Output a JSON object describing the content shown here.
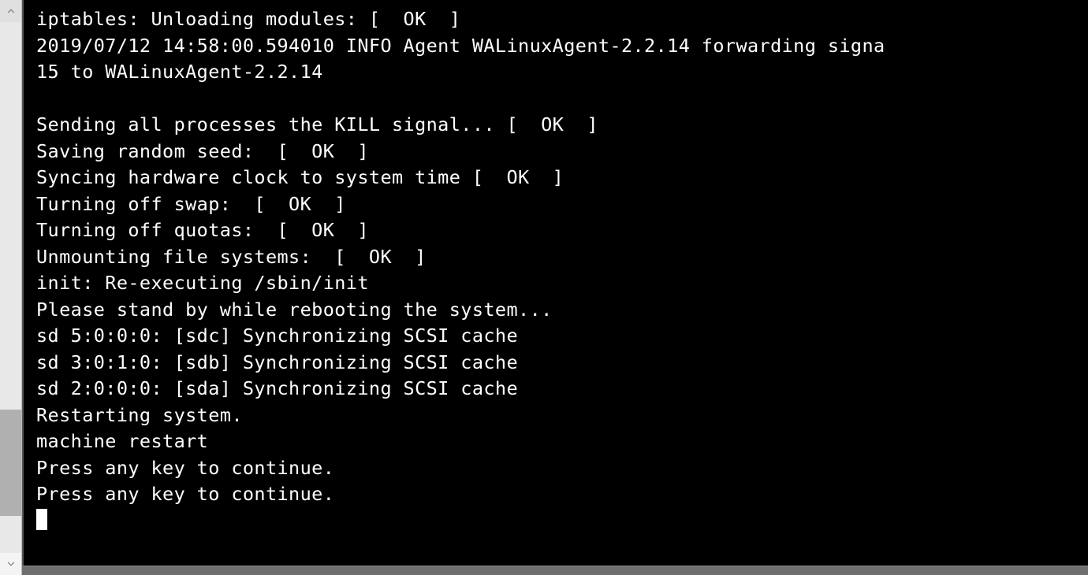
{
  "scrollbar": {
    "thumb_top_pct": 73,
    "thumb_height_pct": 20
  },
  "terminal": {
    "lines": [
      "iptables: Unloading modules: [  OK  ]",
      "2019/07/12 14:58:00.594010 INFO Agent WALinuxAgent-2.2.14 forwarding signa",
      "15 to WALinuxAgent-2.2.14",
      "",
      "Sending all processes the KILL signal... [  OK  ]",
      "Saving random seed:  [  OK  ]",
      "Syncing hardware clock to system time [  OK  ]",
      "Turning off swap:  [  OK  ]",
      "Turning off quotas:  [  OK  ]",
      "Unmounting file systems:  [  OK  ]",
      "init: Re-executing /sbin/init",
      "Please stand by while rebooting the system...",
      "sd 5:0:0:0: [sdc] Synchronizing SCSI cache",
      "sd 3:0:1:0: [sdb] Synchronizing SCSI cache",
      "sd 2:0:0:0: [sda] Synchronizing SCSI cache",
      "Restarting system.",
      "machine restart",
      "Press any key to continue.",
      "Press any key to continue."
    ]
  }
}
